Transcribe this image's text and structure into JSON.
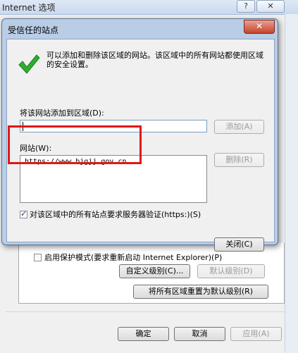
{
  "background": {
    "window_title": "Internet 选项",
    "help_button": "?",
    "close_button": "✕",
    "protected_mode_label": "启用保护模式(要求重新启动 Internet Explorer)(P)",
    "custom_level_button": "自定义级别(C)...",
    "default_level_button": "默认级别(D)",
    "reset_all_button": "将所有区域重置为默认级别(R)",
    "ok_button": "确定",
    "cancel_button": "取消",
    "apply_button": "应用(A)"
  },
  "dialog": {
    "title": "受信任的站点",
    "close_button": "✕",
    "info_text": "可以添加和删除该区域的网站。该区域中的所有网站都使用区域的安全设置。",
    "add_label": "将该网站添加到区域(D):",
    "add_input_value": "",
    "add_button": "添加(A)",
    "websites_label": "网站(W):",
    "websites": [
      "https://www.bjgjj.gov.cn"
    ],
    "remove_button": "删除(R)",
    "require_https_label": "对该区域中的所有站点要求服务器验证(https:)(S)",
    "require_https_checked": true,
    "close_dialog_button": "关闭(C)"
  },
  "colors": {
    "highlight": "#e01818",
    "check_green": "#2fae2f"
  }
}
